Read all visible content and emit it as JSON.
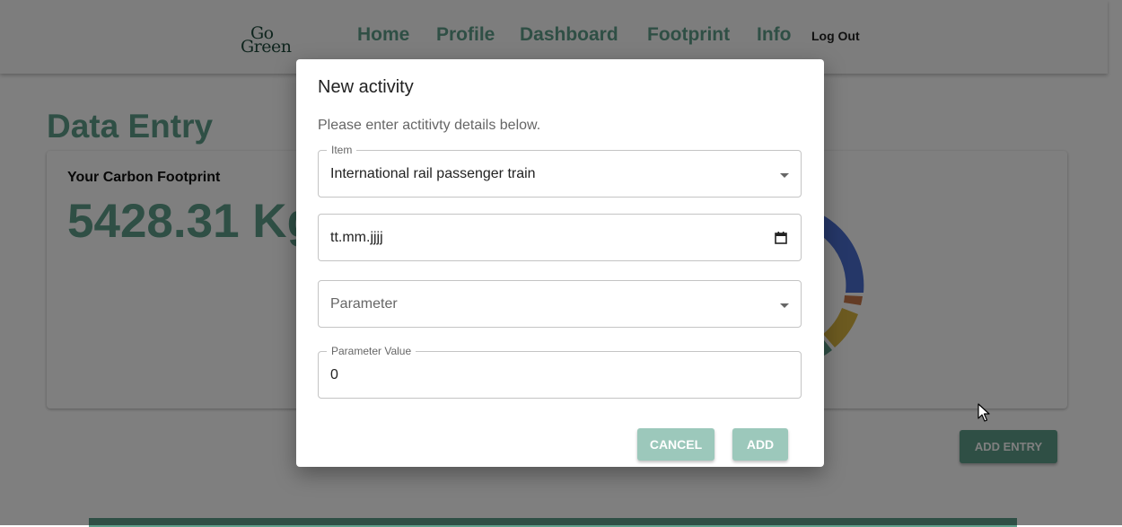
{
  "nav": {
    "logo_line1": "Go",
    "logo_line2": "Green",
    "links": [
      "Home",
      "Profile",
      "Dashboard",
      "Footprint",
      "Info"
    ],
    "logout": "Log Out"
  },
  "page": {
    "title": "Data Entry",
    "card_label": "Your Carbon Footprint",
    "card_value": "5428.31 Kg",
    "add_entry": "ADD ENTRY"
  },
  "colors": {
    "accent": "#5f9e8a",
    "donut": [
      "#4a6fd1",
      "#c9794a",
      "#d8b541",
      "#5f9e8a"
    ]
  },
  "modal": {
    "title": "New activity",
    "description": "Please enter actitivty details below.",
    "item": {
      "label": "Item",
      "value": "International rail passenger train"
    },
    "date": {
      "value": "tt.mm.jjjj",
      "icon": "calendar-icon"
    },
    "parameter": {
      "placeholder": "Parameter"
    },
    "parameter_value": {
      "label": "Parameter Value",
      "value": "0"
    },
    "cancel": "CANCEL",
    "add": "ADD"
  }
}
